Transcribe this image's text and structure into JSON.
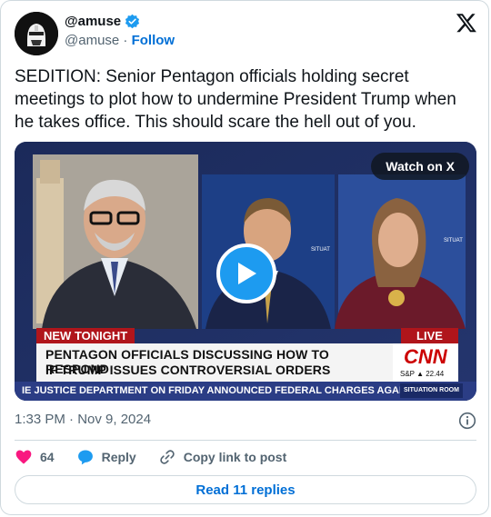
{
  "author": {
    "display_name": "@amuse",
    "handle": "@amuse",
    "separator": "·",
    "follow_label": "Follow"
  },
  "tweet": {
    "text": "SEDITION: Senior Pentagon officials holding secret meetings to plot how to undermine President Trump when he takes office. This should scare the hell out of you."
  },
  "video": {
    "watch_label": "Watch on X",
    "chyron_tag": "NEW TONIGHT",
    "live_tag": "LIVE",
    "headline_line1": "PENTAGON OFFICIALS DISCUSSING HOW TO RESPOND",
    "headline_line2": "IF TRUMP ISSUES CONTROVERSIAL ORDERS",
    "network": "CNN",
    "market": "S&P ▲ 22.44",
    "ticker": "IE JUSTICE DEPARTMENT ON FRIDAY ANNOUNCED FEDERAL CHARGES AGAINST THRE",
    "show": "SITUATION ROOM"
  },
  "meta": {
    "timestamp": "1:33 PM · Nov 9, 2024"
  },
  "actions": {
    "likes_count": "64",
    "reply_label": "Reply",
    "copy_link_label": "Copy link to post"
  },
  "replies_button": "Read 11 replies",
  "colors": {
    "accent": "#1d9bf0",
    "link": "#006fd6",
    "like": "#f91880",
    "cnn_red": "#cc0000"
  }
}
